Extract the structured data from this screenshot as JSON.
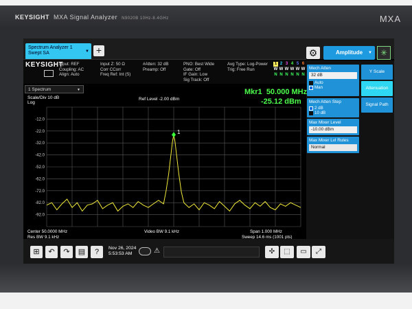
{
  "bezel": {
    "brand": "KEYSIGHT",
    "product": "MXA Signal Analyzer",
    "part": "N9020B 10Hz-8.4GHz",
    "model": "MXA"
  },
  "tab": {
    "line1": "Spectrum Analyzer 1",
    "line2": "Swept SA"
  },
  "menu": {
    "active": "Amplitude"
  },
  "settings": {
    "logo": "KEYSIGHT",
    "col1": [
      "Input: REF",
      "Coupling: AC",
      "Align: Auto"
    ],
    "col2": [
      "Input Z: 50 Ω",
      "Corr CCorr",
      "Freq Ref: Int (S)"
    ],
    "col3": [
      "#Atten: 32 dB",
      "Preamp: Off"
    ],
    "col4": [
      "PNO: Best Wide",
      "Gate: Off",
      "IF Gain: Low",
      "Sig Track: Off"
    ],
    "col5": [
      "Avg Type: Log-Power",
      "Trig: Free Run"
    ],
    "trace_numbers": [
      "1",
      "2",
      "3",
      "4",
      "5",
      "6"
    ],
    "trace_types": [
      "W",
      "W",
      "W",
      "W",
      "W",
      "W"
    ],
    "trace_detectors": [
      "N",
      "N",
      "N",
      "N",
      "N",
      "N"
    ]
  },
  "panel": {
    "mech_atten": {
      "label": "Mech Atten",
      "value": "32 dB",
      "auto": "Auto",
      "man": "Man"
    },
    "mech_step": {
      "label": "Mech Atten Step",
      "opt1": "2 dB",
      "opt2": "10 dB"
    },
    "max_mixer": {
      "label": "Max Mixer Level",
      "value": "-10.00 dBm"
    },
    "mixer_rules": {
      "label": "Max Mixer Lvl Rules",
      "value": "Normal"
    },
    "side_buttons": [
      "Y Scale",
      "Attenuation",
      "Signal Path"
    ]
  },
  "window": {
    "selector": "1 Spectrum"
  },
  "graph": {
    "scale": "Scale/Div 10 dB",
    "scale_type": "Log",
    "ref_level": "Ref Level -2.00 dBm",
    "marker_label": "Mkr1",
    "marker_freq": "50.000 MHz",
    "marker_amp": "-25.12 dBm",
    "marker_id": "1",
    "y_labels": [
      "-12.0",
      "-22.0",
      "-32.0",
      "-42.0",
      "-52.0",
      "-62.0",
      "-72.0",
      "-82.0",
      "-92.0"
    ],
    "center": "Center 50.0000 MHz",
    "res_bw": "Res BW 9.1 kHz",
    "video_bw": "Video BW 9.1 kHz",
    "span": "Span 1.000 MHz",
    "sweep": "Sweep 14.6 ms (1001 pts)",
    "colors": {
      "trace": "#f2ea3a",
      "marker": "#3cff3c",
      "grid": "#5a5a5a"
    }
  },
  "chart_data": {
    "type": "line",
    "xlabel": "",
    "ylabel": "",
    "ylim": [
      -102,
      -2
    ],
    "xlim": [
      49.5,
      50.5
    ],
    "grid": true,
    "series": [
      {
        "x": [
          49.5,
          49.52,
          49.54,
          49.56,
          49.58,
          49.6,
          49.62,
          49.64,
          49.66,
          49.68,
          49.7,
          49.72,
          49.74,
          49.76,
          49.78,
          49.8,
          49.82,
          49.84,
          49.86,
          49.88,
          49.9,
          49.92,
          49.94,
          49.96,
          49.97,
          49.98,
          49.99,
          49.995,
          50.0,
          50.005,
          50.01,
          50.02,
          50.03,
          50.04,
          50.06,
          50.08,
          50.1,
          50.12,
          50.14,
          50.16,
          50.18,
          50.2,
          50.22,
          50.24,
          50.26,
          50.28,
          50.3,
          50.32,
          50.34,
          50.36,
          50.38,
          50.4,
          50.42,
          50.44,
          50.46,
          50.48,
          50.5
        ],
        "values": [
          -84,
          -82,
          -88,
          -83,
          -79,
          -86,
          -82,
          -89,
          -84,
          -83,
          -80,
          -87,
          -84,
          -82,
          -89,
          -85,
          -83,
          -86,
          -81,
          -84,
          -86,
          -83,
          -80,
          -83,
          -72,
          -58,
          -40,
          -31,
          -25.12,
          -31,
          -40,
          -58,
          -73,
          -82,
          -86,
          -83,
          -88,
          -82,
          -84,
          -87,
          -81,
          -85,
          -89,
          -83,
          -80,
          -84,
          -87,
          -82,
          -85,
          -81,
          -86,
          -88,
          -83,
          -85,
          -82,
          -84,
          -86
        ]
      }
    ]
  },
  "taskbar": {
    "date": "Nov 26, 2024",
    "time": "5:53:53 AM"
  }
}
